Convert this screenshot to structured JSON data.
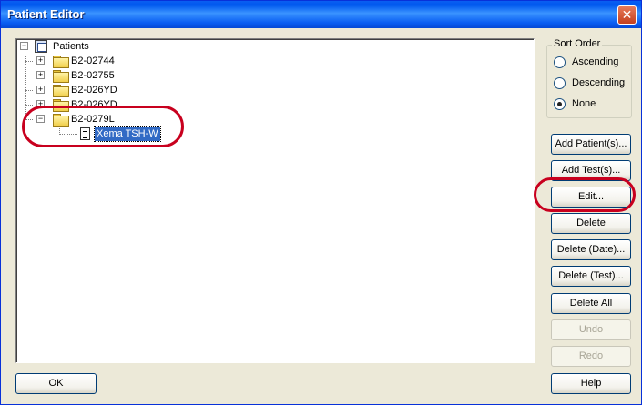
{
  "window": {
    "title": "Patient Editor",
    "close_glyph": "✕"
  },
  "tree": {
    "root": {
      "label": "Patients",
      "expander": "−",
      "icon": "patients-root-icon"
    },
    "patients": [
      {
        "label": "B2-02744",
        "expander": "+"
      },
      {
        "label": "B2-02755",
        "expander": "+"
      },
      {
        "label": "B2-026YD",
        "expander": "+"
      },
      {
        "label": "B2-026YD",
        "expander": "+"
      },
      {
        "label": "B2-0279L",
        "expander": "−"
      }
    ],
    "test": {
      "label": "Xema TSH-W",
      "selected": true,
      "icon": "document-icon"
    }
  },
  "sort_order": {
    "title": "Sort Order",
    "options": [
      {
        "label": "Ascending",
        "checked": false
      },
      {
        "label": "Descending",
        "checked": false
      },
      {
        "label": "None",
        "checked": true
      }
    ]
  },
  "buttons": {
    "add_patients": "Add Patient(s)...",
    "add_tests": "Add Test(s)...",
    "edit": "Edit...",
    "delete": "Delete",
    "delete_date": "Delete (Date)...",
    "delete_test": "Delete (Test)...",
    "delete_all": "Delete All",
    "undo": "Undo",
    "redo": "Redo",
    "help": "Help",
    "ok": "OK"
  },
  "colors": {
    "annotation": "#c8001e",
    "selection": "#316ac5",
    "titlebar": "#0a5ef2"
  }
}
